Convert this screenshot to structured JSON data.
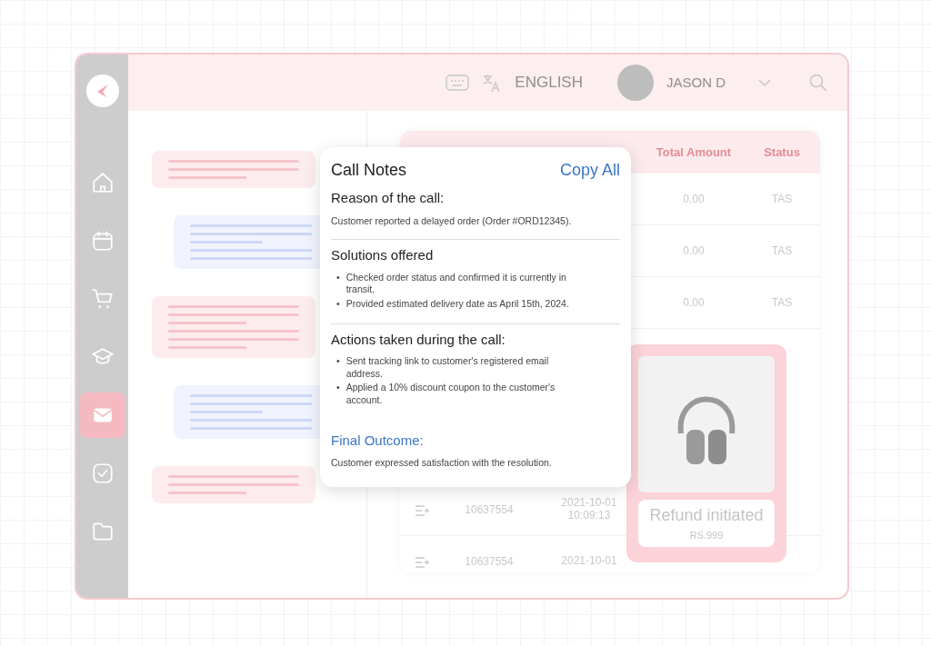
{
  "sidebar": {
    "items": [
      {
        "kind": "home",
        "selected": false
      },
      {
        "kind": "calendar",
        "selected": false
      },
      {
        "kind": "cart",
        "selected": false
      },
      {
        "kind": "graduation",
        "selected": false
      },
      {
        "kind": "mail",
        "selected": true
      },
      {
        "kind": "check",
        "selected": false
      },
      {
        "kind": "folder",
        "selected": false
      }
    ]
  },
  "topbar": {
    "language": "ENGLISH",
    "user": "JASON D"
  },
  "chat_bubbles": [
    {
      "kind": "incoming"
    },
    {
      "kind": "outgoing"
    },
    {
      "kind": "incoming"
    },
    {
      "kind": "outgoing"
    },
    {
      "kind": "incoming"
    }
  ],
  "table": {
    "columns": [
      "Total Amount",
      "Status"
    ],
    "rows": [
      {
        "kind": "summary",
        "amount": "0.00",
        "status": "TAS"
      },
      {
        "kind": "summary",
        "amount": "0.00",
        "status": "TAS"
      },
      {
        "kind": "summary",
        "amount": "0.00",
        "status": "TAS"
      },
      {
        "kind": "order",
        "id": "10637554",
        "date": "2021-10-01",
        "time": "10:09:13"
      },
      {
        "kind": "order",
        "id": "10637554",
        "date": "2021-10-01"
      }
    ]
  },
  "refund_card": {
    "title": "Refund initiated",
    "amount": "RS.999"
  },
  "call_notes": {
    "title": "Call Notes",
    "action": "Copy All",
    "sections": [
      {
        "kind": "text",
        "heading": "Reason of the call:",
        "text": "Customer reported a delayed order (Order #ORD12345)."
      },
      {
        "kind": "bullets",
        "heading": "Solutions offered",
        "marker": "•",
        "items": [
          "Checked order status and confirmed it is currently in transit.",
          "Provided estimated delivery date as April 15th, 2024."
        ]
      },
      {
        "kind": "bullets",
        "heading": "Actions taken during the call:",
        "marker": "•",
        "items": [
          "Sent tracking link to customer's registered email address.",
          "Applied a 10% discount coupon to the customer's account."
        ]
      }
    ],
    "outcome": {
      "heading": "Final Outcome:",
      "text": "Customer expressed satisfaction with the resolution."
    }
  }
}
